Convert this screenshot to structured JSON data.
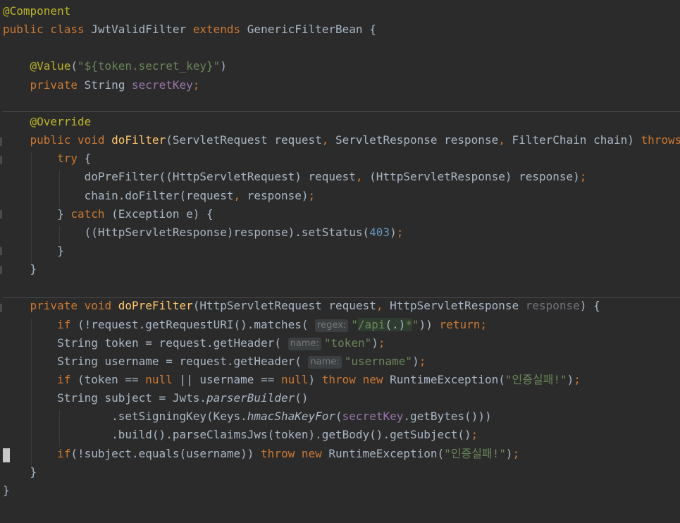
{
  "lines": [
    [
      {
        "t": "@Component",
        "c": "ann"
      }
    ],
    [
      {
        "t": "public class ",
        "c": "kw"
      },
      {
        "t": "JwtValidFilter ",
        "c": "pl"
      },
      {
        "t": "extends ",
        "c": "kw"
      },
      {
        "t": "GenericFilterBean {",
        "c": "pl"
      }
    ],
    [],
    [
      {
        "t": "    @Value",
        "c": "ann"
      },
      {
        "t": "(",
        "c": "pl"
      },
      {
        "t": "\"${token.secret_key}\"",
        "c": "str"
      },
      {
        "t": ")",
        "c": "pl"
      }
    ],
    [
      {
        "t": "    private ",
        "c": "kw"
      },
      {
        "t": "String ",
        "c": "pl"
      },
      {
        "t": "secretKey",
        "c": "fld"
      },
      {
        "t": ";",
        "c": "kw"
      }
    ],
    [],
    [
      {
        "t": "    @Override",
        "c": "ann"
      }
    ],
    [
      {
        "t": "    public void ",
        "c": "kw"
      },
      {
        "t": "doFilter",
        "c": "fn"
      },
      {
        "t": "(ServletRequest request",
        "c": "pl"
      },
      {
        "t": ", ",
        "c": "kw"
      },
      {
        "t": "ServletResponse response",
        "c": "pl"
      },
      {
        "t": ", ",
        "c": "kw"
      },
      {
        "t": "FilterChain chain) ",
        "c": "pl"
      },
      {
        "t": "throws",
        "c": "kw"
      }
    ],
    [
      {
        "t": "        try ",
        "c": "kw"
      },
      {
        "t": "{",
        "c": "pl"
      }
    ],
    [
      {
        "t": "            doPreFilter((HttpServletRequest) request",
        "c": "pl"
      },
      {
        "t": ", ",
        "c": "kw"
      },
      {
        "t": "(HttpServletResponse) response)",
        "c": "pl"
      },
      {
        "t": ";",
        "c": "kw"
      }
    ],
    [
      {
        "t": "            chain.doFilter(request",
        "c": "pl"
      },
      {
        "t": ", ",
        "c": "kw"
      },
      {
        "t": "response)",
        "c": "pl"
      },
      {
        "t": ";",
        "c": "kw"
      }
    ],
    [
      {
        "t": "        } ",
        "c": "pl"
      },
      {
        "t": "catch ",
        "c": "kw"
      },
      {
        "t": "(Exception e) {",
        "c": "pl"
      }
    ],
    [
      {
        "t": "            ((HttpServletResponse)response).setStatus(",
        "c": "pl"
      },
      {
        "t": "403",
        "c": "num"
      },
      {
        "t": ")",
        "c": "pl"
      },
      {
        "t": ";",
        "c": "kw"
      }
    ],
    [
      {
        "t": "        }",
        "c": "pl"
      }
    ],
    [
      {
        "t": "    }",
        "c": "pl"
      }
    ],
    [],
    [
      {
        "t": "    private void ",
        "c": "kw"
      },
      {
        "t": "doPreFilter",
        "c": "fn"
      },
      {
        "t": "(HttpServletRequest request",
        "c": "pl"
      },
      {
        "t": ", ",
        "c": "kw"
      },
      {
        "t": "HttpServletResponse ",
        "c": "pl"
      },
      {
        "t": "response",
        "c": "dim"
      },
      {
        "t": ") {",
        "c": "pl"
      }
    ],
    [
      {
        "t": "        if ",
        "c": "kw"
      },
      {
        "t": "(!request.getRequestURI().matches( ",
        "c": "pl"
      },
      {
        "h": "regex:"
      },
      {
        "t": "\"",
        "c": "str"
      },
      {
        "t": "/api",
        "c": "str rx"
      },
      {
        "t": "(.)",
        "c": "pl rx"
      },
      {
        "t": "*",
        "c": "str rx"
      },
      {
        "t": "\"",
        "c": "str"
      },
      {
        "t": ")) ",
        "c": "pl"
      },
      {
        "t": "return;",
        "c": "kw"
      }
    ],
    [
      {
        "t": "        String token = request.getHeader( ",
        "c": "pl"
      },
      {
        "h": "name:"
      },
      {
        "t": "\"token\"",
        "c": "str"
      },
      {
        "t": ")",
        "c": "pl"
      },
      {
        "t": ";",
        "c": "kw"
      }
    ],
    [
      {
        "t": "        String username = request.getHeader( ",
        "c": "pl"
      },
      {
        "h": "name:"
      },
      {
        "t": "\"username\"",
        "c": "str"
      },
      {
        "t": ")",
        "c": "pl"
      },
      {
        "t": ";",
        "c": "kw"
      }
    ],
    [
      {
        "t": "        if ",
        "c": "kw"
      },
      {
        "t": "(token == ",
        "c": "pl"
      },
      {
        "t": "null ",
        "c": "kw"
      },
      {
        "t": "|| username == ",
        "c": "pl"
      },
      {
        "t": "null",
        "c": "kw"
      },
      {
        "t": ") ",
        "c": "pl"
      },
      {
        "t": "throw new ",
        "c": "kw"
      },
      {
        "t": "RuntimeException(",
        "c": "pl"
      },
      {
        "t": "\"인증실패!\"",
        "c": "str"
      },
      {
        "t": ")",
        "c": "pl"
      },
      {
        "t": ";",
        "c": "kw"
      }
    ],
    [
      {
        "t": "        String subject = Jwts.",
        "c": "pl"
      },
      {
        "t": "parserBuilder",
        "c": "pl it"
      },
      {
        "t": "()",
        "c": "pl"
      }
    ],
    [
      {
        "t": "                .setSigningKey(Keys.",
        "c": "pl"
      },
      {
        "t": "hmacShaKeyFor",
        "c": "pl it"
      },
      {
        "t": "(",
        "c": "pl"
      },
      {
        "t": "secretKey",
        "c": "fld"
      },
      {
        "t": ".getBytes()))",
        "c": "pl"
      }
    ],
    [
      {
        "t": "                .build().parseClaimsJws(token).getBody().getSubject()",
        "c": "pl"
      },
      {
        "t": ";",
        "c": "kw"
      }
    ],
    [
      {
        "t": "        if",
        "c": "kw"
      },
      {
        "t": "(!subject.equals(username)) ",
        "c": "pl"
      },
      {
        "t": "throw new ",
        "c": "kw"
      },
      {
        "t": "RuntimeException(",
        "c": "pl"
      },
      {
        "t": "\"인증실패!\"",
        "c": "str"
      },
      {
        "t": ")",
        "c": "pl"
      },
      {
        "t": ";",
        "c": "kw"
      }
    ],
    [
      {
        "t": "    }",
        "c": "pl"
      }
    ],
    [
      {
        "t": "}",
        "c": "pl"
      }
    ]
  ],
  "caret_line": 25,
  "colors": {
    "background": "#2b2b2b",
    "keyword": "#cc7832",
    "annotation": "#bbb529",
    "string": "#6a8759",
    "number": "#6897bb",
    "field": "#9876aa",
    "method": "#ffc66d",
    "text": "#a9b7c6"
  }
}
